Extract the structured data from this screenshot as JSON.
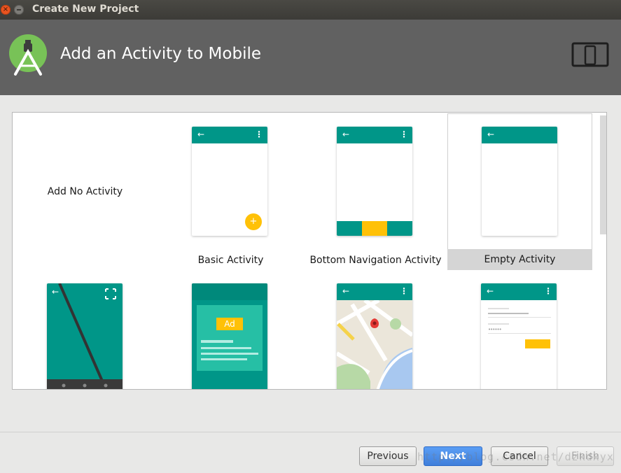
{
  "window": {
    "title": "Create New Project"
  },
  "header": {
    "title": "Add an Activity to Mobile"
  },
  "templates": [
    {
      "label": "Add No Activity"
    },
    {
      "label": "Basic Activity"
    },
    {
      "label": "Bottom Navigation Activity"
    },
    {
      "label": "Empty Activity",
      "selected": true
    },
    {
      "label": ""
    },
    {
      "label": ""
    },
    {
      "label": ""
    },
    {
      "label": ""
    }
  ],
  "ad_badge": "Ad",
  "buttons": {
    "previous": "Previous",
    "next": "Next",
    "cancel": "Cancel",
    "finish": "Finish"
  },
  "watermark": "http://blog.csdn.net/dzkdxyx",
  "colors": {
    "primary": "#009688",
    "accent": "#ffc107",
    "header": "#616161",
    "selected_tile": "#d5d5d5"
  }
}
